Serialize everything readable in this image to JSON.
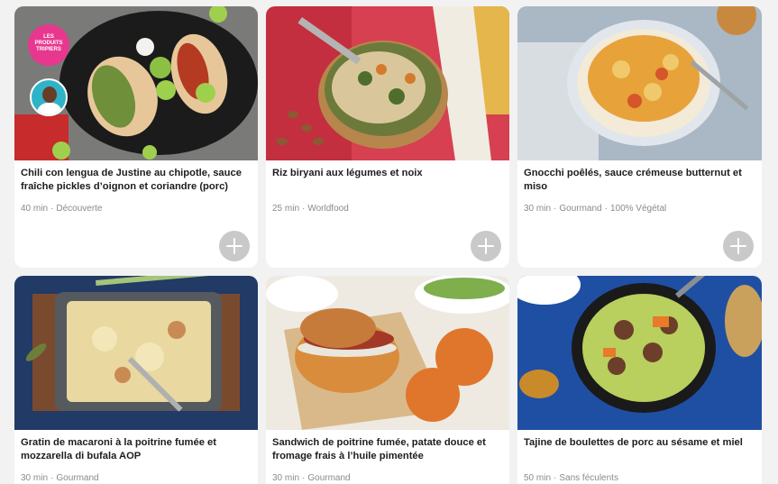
{
  "recipes": [
    {
      "title": "Chili con lengua de Justine au chipotle, sauce fraîche pickles d’oignon et coriandre (porc)",
      "time": "40 min",
      "tags": [
        "Découverte"
      ],
      "badge_lines": [
        "LES",
        "PRODUITS",
        "TRIPIERS"
      ],
      "image_icon": "tacos-plate"
    },
    {
      "title": "Riz biryani aux légumes et noix",
      "time": "25 min",
      "tags": [
        "Worldfood"
      ],
      "image_icon": "rice-bowl"
    },
    {
      "title": "Gnocchi poêlés, sauce crémeuse butternut et miso",
      "time": "30 min",
      "tags": [
        "Gourmand",
        "100% Végétal"
      ],
      "image_icon": "gnocchi-plate"
    },
    {
      "title": "Gratin de macaroni à la poitrine fumée et mozzarella di bufala AOP",
      "time": "30 min",
      "tags": [
        "Gourmand"
      ],
      "image_icon": "gratin-dish"
    },
    {
      "title": "Sandwich de poitrine fumée, patate douce et fromage frais à l’huile pimentée",
      "time": "30 min",
      "tags": [
        "Gourmand"
      ],
      "image_icon": "sandwich"
    },
    {
      "title": "Tajine de boulettes de porc au sésame et miel",
      "time": "50 min",
      "tags": [
        "Sans féculents"
      ],
      "image_icon": "tajine-bowl"
    }
  ],
  "colors": {
    "background": "#f2f2f2",
    "card": "#ffffff",
    "add_button": "#c9c9c9",
    "badge": "#e8378f",
    "meta_text": "#8a8a8a"
  }
}
